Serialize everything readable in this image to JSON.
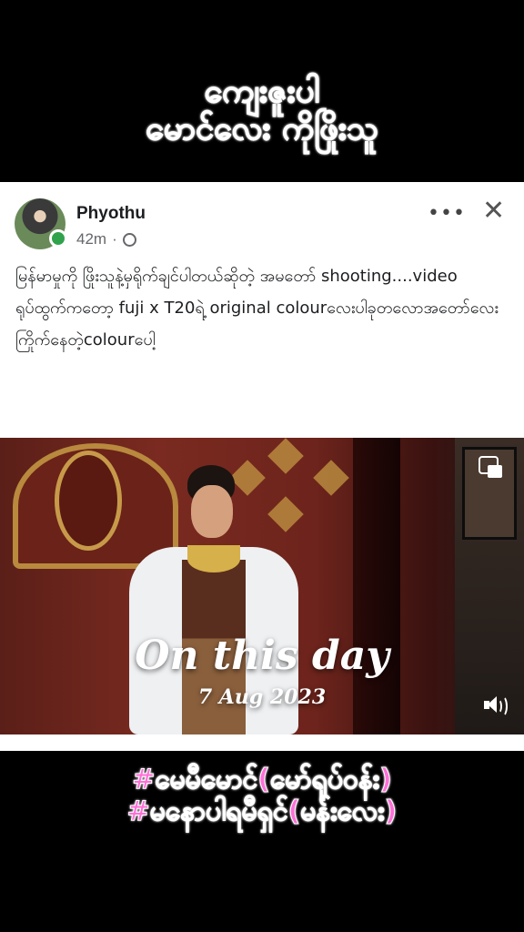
{
  "overlay": {
    "top_caption_line1": "ကျေးဇူးပါ",
    "top_caption_line2": "မောင်လေး ကိုဖြိုးသူ",
    "bottom_caption_line1": "#မေမီမောင်(မော်ရုပ်ဝန်း)",
    "bottom_caption_line2": "#မနောပါရမီရှင်(မန်းလေး)"
  },
  "post": {
    "author": "Phyothu",
    "time": "42m",
    "separator": "·",
    "more_label": "•••",
    "close_label": "✕",
    "text": "မြန်မာမှုကို ဖြိုးသူနဲ့မှရိုက်ချင်ပါတယ်ဆိုတဲ့ အမတော် shooting....video ရုပ်ထွက်ကတော့ fuji x T20ရဲ့ original colourလေးပါခုတလောအတော်လေးကြိုက်နေတဲ့colourပေါ့"
  },
  "video": {
    "overlay_title": "On this day",
    "overlay_date": "7 Aug 2023"
  },
  "icons": {
    "privacy": "globe-icon",
    "pip": "picture-in-picture-icon",
    "sound": "speaker-icon"
  },
  "colors": {
    "caption": "#ff6fd8",
    "online": "#31a24c"
  }
}
